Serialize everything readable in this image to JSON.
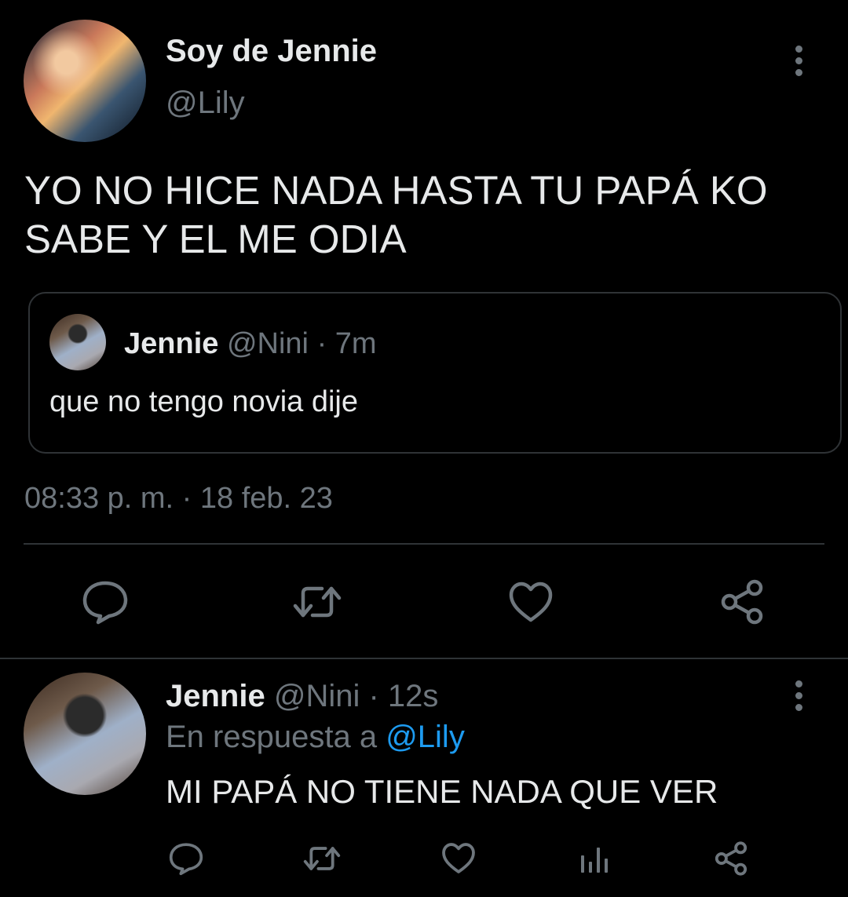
{
  "main_tweet": {
    "display_name": "Soy de Jennie",
    "handle": "@Lily",
    "text_line1": "YO NO HICE NADA HASTA TU PAPÁ KO",
    "text_line2": "SABE Y EL ME ODIA",
    "timestamp": "08:33 p. m. · 18 feb. 23"
  },
  "quoted_tweet": {
    "display_name": "Jennie",
    "handle": "@Nini",
    "time": "· 7m",
    "text": "que no tengo novia dije"
  },
  "reply": {
    "display_name": "Jennie",
    "handle": "@Nini",
    "time": "· 12s",
    "reply_prefix": "En respuesta a",
    "reply_to": "@Lily",
    "text": "MI PAPÁ NO TIENE NADA QUE VER"
  },
  "actions_main": [
    "reply-icon",
    "retweet-icon",
    "like-icon",
    "share-icon"
  ],
  "actions_reply": [
    "reply-icon",
    "retweet-icon",
    "like-icon",
    "analytics-icon",
    "share-icon"
  ],
  "colors": {
    "background": "#000000",
    "text": "#e7e9ea",
    "muted": "#6e767d",
    "link": "#1d9bf0",
    "border": "#2f3336"
  }
}
